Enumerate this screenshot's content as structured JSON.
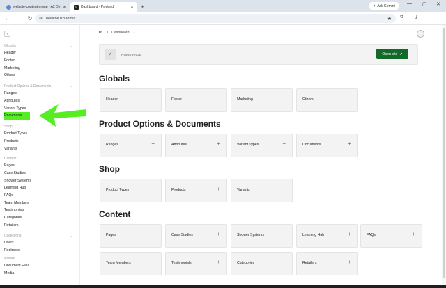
{
  "browser": {
    "tabs": [
      {
        "title": "website-content-group - A2 De",
        "active": false
      },
      {
        "title": "Dashboard - Payload",
        "active": true
      }
    ],
    "favicon_text": "PL",
    "new_tab": "+",
    "ask_gemini": "Ask Gemini",
    "url": "newline.nz/admin",
    "window_controls": {
      "minimize": "—",
      "maximize": "▢",
      "close": "✕"
    }
  },
  "breadcrumb": {
    "root": "PL",
    "separator": "/",
    "current": "Dashboard"
  },
  "hero": {
    "label": "HOME PAGE",
    "button": "Open site"
  },
  "sidebar": [
    {
      "label": "Globals",
      "items": [
        "Header",
        "Footer",
        "Marketing",
        "Others"
      ]
    },
    {
      "label": "Product Options & Documents",
      "items": [
        "Ranges",
        "Attributes",
        "Variant Types",
        "Documents"
      ]
    },
    {
      "label": "Shop",
      "items": [
        "Product Types",
        "Products",
        "Variants"
      ]
    },
    {
      "label": "Content",
      "items": [
        "Pages",
        "Case Studies",
        "Shower Systems",
        "Learning Hub",
        "FAQs",
        "Team Members",
        "Testimonials",
        "Categories",
        "Retailers"
      ]
    },
    {
      "label": "Collections",
      "items": [
        "Users",
        "Redirects"
      ]
    },
    {
      "label": "Assets",
      "items": [
        "Document Files",
        "Media"
      ]
    }
  ],
  "highlighted_item": "Documents",
  "annotation_color": "#55ee22",
  "sections": [
    {
      "title": "Globals",
      "cards": [
        {
          "label": "Header",
          "plus": false
        },
        {
          "label": "Footer",
          "plus": false
        },
        {
          "label": "Marketing",
          "plus": false
        },
        {
          "label": "Others",
          "plus": false
        }
      ]
    },
    {
      "title": "Product Options & Documents",
      "cards": [
        {
          "label": "Ranges",
          "plus": true
        },
        {
          "label": "Attributes",
          "plus": true
        },
        {
          "label": "Variant Types",
          "plus": true
        },
        {
          "label": "Documents",
          "plus": true
        }
      ]
    },
    {
      "title": "Shop",
      "cards": [
        {
          "label": "Product Types",
          "plus": true
        },
        {
          "label": "Products",
          "plus": true
        },
        {
          "label": "Variants",
          "plus": true
        }
      ]
    },
    {
      "title": "Content",
      "cards": [
        {
          "label": "Pages",
          "plus": true
        },
        {
          "label": "Case Studies",
          "plus": true
        },
        {
          "label": "Shower Systems",
          "plus": true
        },
        {
          "label": "Learning Hub",
          "plus": true
        },
        {
          "label": "FAQs",
          "plus": true
        },
        {
          "label": "Team Members",
          "plus": true
        },
        {
          "label": "Testimonials",
          "plus": true
        },
        {
          "label": "Categories",
          "plus": true
        },
        {
          "label": "Retailers",
          "plus": true
        }
      ]
    }
  ],
  "colors": {
    "accent_button": "#116a2a",
    "card_bg": "#f3f3f3"
  }
}
